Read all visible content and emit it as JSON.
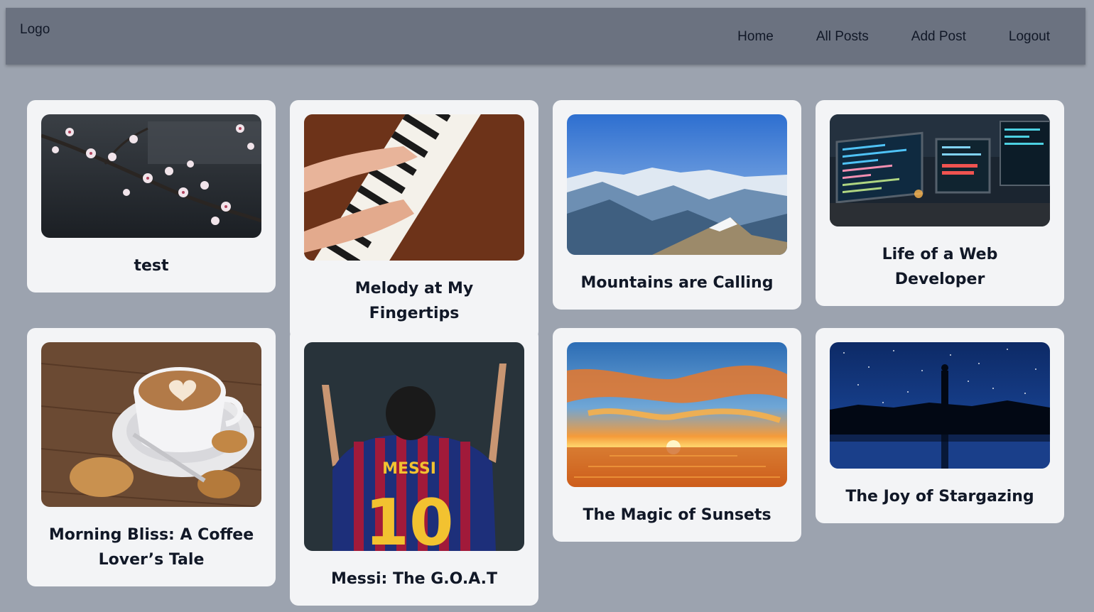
{
  "navbar": {
    "logo": "Logo",
    "links": [
      "Home",
      "All Posts",
      "Add Post",
      "Logout"
    ]
  },
  "posts": [
    {
      "title": "test",
      "image": "cherry-blossom-branch"
    },
    {
      "title": "Melody at My Fingertips",
      "image": "hands-on-piano"
    },
    {
      "title": "Mountains are Calling",
      "image": "mountain-range"
    },
    {
      "title": "Life of a Web Developer",
      "image": "laptops-with-code"
    },
    {
      "title": "Morning Bliss: A Coffee Lover’s Tale",
      "image": "latte-with-cookies"
    },
    {
      "title": "Messi: The G.O.A.T",
      "image": "messi-celebrating"
    },
    {
      "title": "The Magic of Sunsets",
      "image": "sunset-over-sea"
    },
    {
      "title": "The Joy of Stargazing",
      "image": "starry-night-silhouette"
    }
  ]
}
